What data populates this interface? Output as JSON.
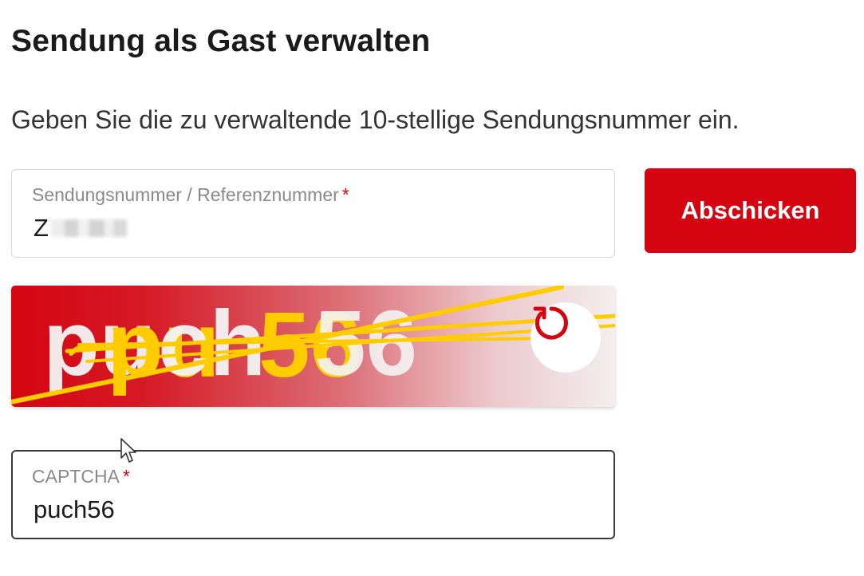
{
  "page": {
    "title": "Sendung als Gast verwalten",
    "intro": "Geben Sie die zu verwaltende 10-stellige Sendungsnummer ein."
  },
  "reference_field": {
    "label": "Sendungsnummer / Referenznummer",
    "required_marker": "*",
    "value_visible_prefix": "Z"
  },
  "submit_button": {
    "label": "Abschicken"
  },
  "captcha": {
    "image_text_part1": "pu",
    "image_text_part2": "ch",
    "image_text_part3": "56",
    "refresh_icon": "refresh-icon"
  },
  "captcha_field": {
    "label": "CAPTCHA",
    "required_marker": "*",
    "value": "puch56"
  },
  "colors": {
    "brand_red": "#d40511",
    "captcha_yellow": "#ffcc00"
  }
}
